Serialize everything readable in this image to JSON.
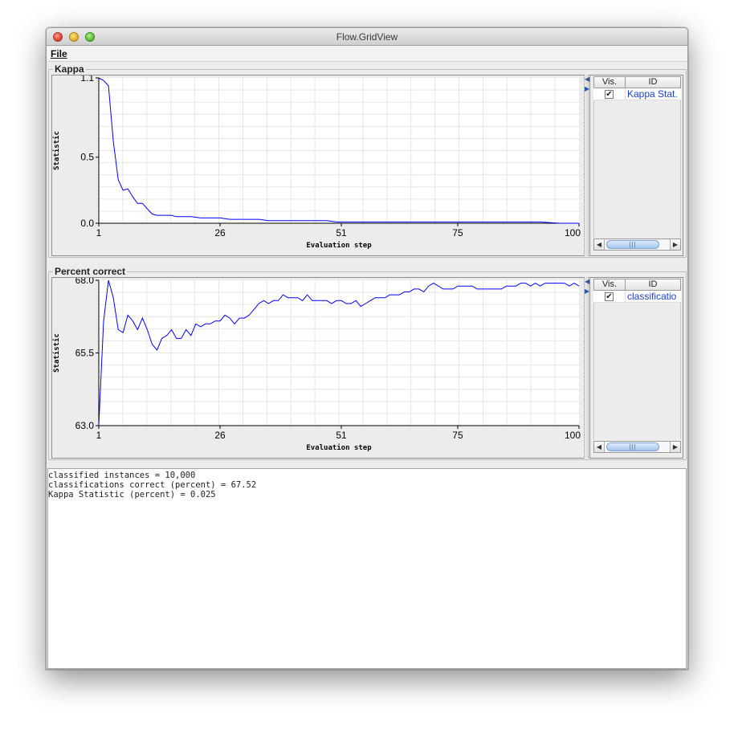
{
  "window": {
    "title": "Flow.GridView"
  },
  "menu": {
    "file_label": "File"
  },
  "panels": [
    {
      "title": "Kappa",
      "legend": {
        "vis_header": "Vis.",
        "id_header": "ID",
        "series_id": "Kappa Stat.",
        "checked": true
      },
      "chart_data": {
        "type": "line",
        "title": "Kappa",
        "xlabel": "Evaluation step",
        "ylabel": "Statistic",
        "xlim": [
          1,
          100
        ],
        "ylim": [
          0.0,
          1.1
        ],
        "x_ticks": [
          "1",
          "26",
          "51",
          "75",
          "100"
        ],
        "y_ticks": [
          "1.1",
          "0.5",
          "0.0"
        ],
        "grid": true,
        "series": [
          {
            "color": "#0000ff",
            "x": [
              1,
              2,
              3,
              4,
              5,
              6,
              7,
              8,
              9,
              10,
              11,
              12,
              13,
              14,
              15,
              16,
              17,
              18,
              19,
              20,
              22,
              24,
              26,
              28,
              30,
              32,
              34,
              36,
              38,
              40,
              42,
              44,
              46,
              48,
              50,
              52,
              54,
              56,
              58,
              60,
              64,
              68,
              72,
              76,
              80,
              84,
              88,
              92,
              96,
              100
            ],
            "y": [
              1.1,
              1.08,
              1.04,
              0.62,
              0.33,
              0.25,
              0.26,
              0.2,
              0.15,
              0.15,
              0.11,
              0.07,
              0.06,
              0.06,
              0.06,
              0.06,
              0.05,
              0.05,
              0.05,
              0.05,
              0.04,
              0.04,
              0.04,
              0.03,
              0.03,
              0.03,
              0.03,
              0.02,
              0.02,
              0.02,
              0.02,
              0.02,
              0.02,
              0.02,
              0.01,
              0.01,
              0.01,
              0.01,
              0.01,
              0.01,
              0.01,
              0.01,
              0.01,
              0.01,
              0.01,
              0.01,
              0.01,
              0.01,
              0.0,
              0.0
            ]
          }
        ]
      }
    },
    {
      "title": "Percent correct",
      "legend": {
        "vis_header": "Vis.",
        "id_header": "ID",
        "series_id": "classificatio",
        "checked": true
      },
      "chart_data": {
        "type": "line",
        "title": "Percent correct",
        "xlabel": "Evaluation step",
        "ylabel": "Statistic",
        "xlim": [
          1,
          100
        ],
        "ylim": [
          63.0,
          68.0
        ],
        "x_ticks": [
          "1",
          "26",
          "51",
          "75",
          "100"
        ],
        "y_ticks": [
          "68.0",
          "65.5",
          "63.0"
        ],
        "grid": true,
        "series": [
          {
            "color": "#0000ff",
            "x": [
              1,
              2,
              3,
              4,
              5,
              6,
              7,
              8,
              9,
              10,
              11,
              12,
              13,
              14,
              15,
              16,
              17,
              18,
              19,
              20,
              21,
              22,
              23,
              24,
              25,
              26,
              27,
              28,
              29,
              30,
              31,
              32,
              33,
              34,
              35,
              36,
              37,
              38,
              39,
              40,
              41,
              42,
              43,
              44,
              45,
              46,
              47,
              48,
              49,
              50,
              51,
              52,
              53,
              54,
              55,
              56,
              57,
              58,
              59,
              60,
              61,
              62,
              63,
              64,
              65,
              66,
              67,
              68,
              69,
              70,
              71,
              72,
              73,
              74,
              75,
              76,
              77,
              78,
              79,
              80,
              81,
              82,
              83,
              84,
              85,
              86,
              87,
              88,
              89,
              90,
              91,
              92,
              93,
              94,
              95,
              96,
              97,
              98,
              99,
              100
            ],
            "y": [
              63.0,
              66.6,
              68.0,
              67.4,
              66.3,
              66.2,
              66.8,
              66.6,
              66.3,
              66.7,
              66.3,
              65.8,
              65.6,
              66.0,
              66.1,
              66.3,
              66.0,
              66.0,
              66.3,
              66.1,
              66.5,
              66.4,
              66.5,
              66.5,
              66.6,
              66.6,
              66.8,
              66.7,
              66.5,
              66.7,
              66.7,
              66.8,
              67.0,
              67.2,
              67.3,
              67.2,
              67.3,
              67.3,
              67.5,
              67.4,
              67.4,
              67.4,
              67.3,
              67.5,
              67.3,
              67.3,
              67.3,
              67.3,
              67.2,
              67.3,
              67.3,
              67.2,
              67.2,
              67.3,
              67.1,
              67.2,
              67.3,
              67.4,
              67.4,
              67.4,
              67.5,
              67.5,
              67.5,
              67.6,
              67.6,
              67.7,
              67.7,
              67.6,
              67.8,
              67.9,
              67.8,
              67.7,
              67.7,
              67.7,
              67.8,
              67.8,
              67.8,
              67.8,
              67.7,
              67.7,
              67.7,
              67.7,
              67.7,
              67.7,
              67.8,
              67.8,
              67.8,
              67.9,
              67.9,
              67.8,
              67.9,
              67.8,
              67.9,
              67.9,
              67.9,
              67.9,
              67.9,
              67.8,
              67.9,
              67.8
            ]
          }
        ]
      }
    }
  ],
  "output": {
    "lines": [
      "classified instances = 10,000",
      "classifications correct (percent) = 67.52",
      "Kappa Statistic (percent) = 0.025"
    ]
  }
}
